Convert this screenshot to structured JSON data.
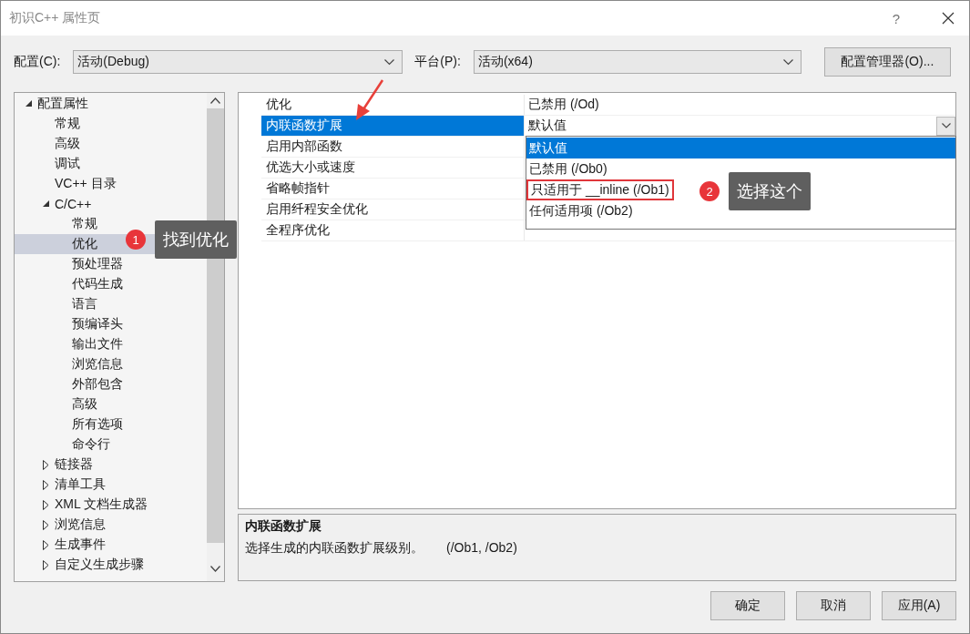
{
  "window": {
    "title": "初识C++ 属性页",
    "help": "?"
  },
  "toolbar": {
    "configuration": {
      "label": "配置(C):",
      "value": "活动(Debug)"
    },
    "platform": {
      "label": "平台(P):",
      "value": "活动(x64)"
    },
    "manager_button": "配置管理器(O)..."
  },
  "tree": [
    {
      "label": "配置属性",
      "expanded": true,
      "selected": false,
      "children": [
        {
          "label": "常规",
          "selected": false
        },
        {
          "label": "高级",
          "selected": false
        },
        {
          "label": "调试",
          "selected": false
        },
        {
          "label": "VC++ 目录",
          "selected": false
        },
        {
          "label": "C/C++",
          "expanded": true,
          "selected": false,
          "children": [
            {
              "label": "常规",
              "selected": false
            },
            {
              "label": "优化",
              "selected": true
            },
            {
              "label": "预处理器",
              "selected": false
            },
            {
              "label": "代码生成",
              "selected": false
            },
            {
              "label": "语言",
              "selected": false
            },
            {
              "label": "预编译头",
              "selected": false
            },
            {
              "label": "输出文件",
              "selected": false
            },
            {
              "label": "浏览信息",
              "selected": false
            },
            {
              "label": "外部包含",
              "selected": false
            },
            {
              "label": "高级",
              "selected": false
            },
            {
              "label": "所有选项",
              "selected": false
            },
            {
              "label": "命令行",
              "selected": false
            }
          ]
        },
        {
          "label": "链接器",
          "expanded": false,
          "selected": false
        },
        {
          "label": "清单工具",
          "expanded": false,
          "selected": false
        },
        {
          "label": "XML 文档生成器",
          "expanded": false,
          "selected": false
        },
        {
          "label": "浏览信息",
          "expanded": false,
          "selected": false
        },
        {
          "label": "生成事件",
          "expanded": false,
          "selected": false
        },
        {
          "label": "自定义生成步骤",
          "expanded": false,
          "selected": false
        }
      ]
    }
  ],
  "properties": [
    {
      "name": "优化",
      "value": "已禁用 (/Od)",
      "selected": false
    },
    {
      "name": "内联函数扩展",
      "value": "默认值",
      "selected": true
    },
    {
      "name": "启用内部函数",
      "selected": false
    },
    {
      "name": "优选大小或速度",
      "selected": false
    },
    {
      "name": "省略帧指针",
      "selected": false
    },
    {
      "name": "启用纤程安全优化",
      "selected": false
    },
    {
      "name": "全程序优化",
      "selected": false
    }
  ],
  "dropdown": [
    {
      "label": "默认值",
      "selected": true,
      "marked": false
    },
    {
      "label": "已禁用 (/Ob0)",
      "selected": false,
      "marked": false
    },
    {
      "label": "只适用于 __inline (/Ob1)",
      "selected": false,
      "marked": true
    },
    {
      "label": "任何适用项 (/Ob2)",
      "selected": false,
      "marked": false
    }
  ],
  "description": {
    "title": "内联函数扩展",
    "text": "选择生成的内联函数扩展级别。",
    "switches": "(/Ob1, /Ob2)"
  },
  "buttons": [
    "确定",
    "取消",
    "应用(A)"
  ],
  "callouts": [
    {
      "number": "1",
      "text": "找到优化"
    },
    {
      "number": "2",
      "text": "选择这个"
    }
  ]
}
